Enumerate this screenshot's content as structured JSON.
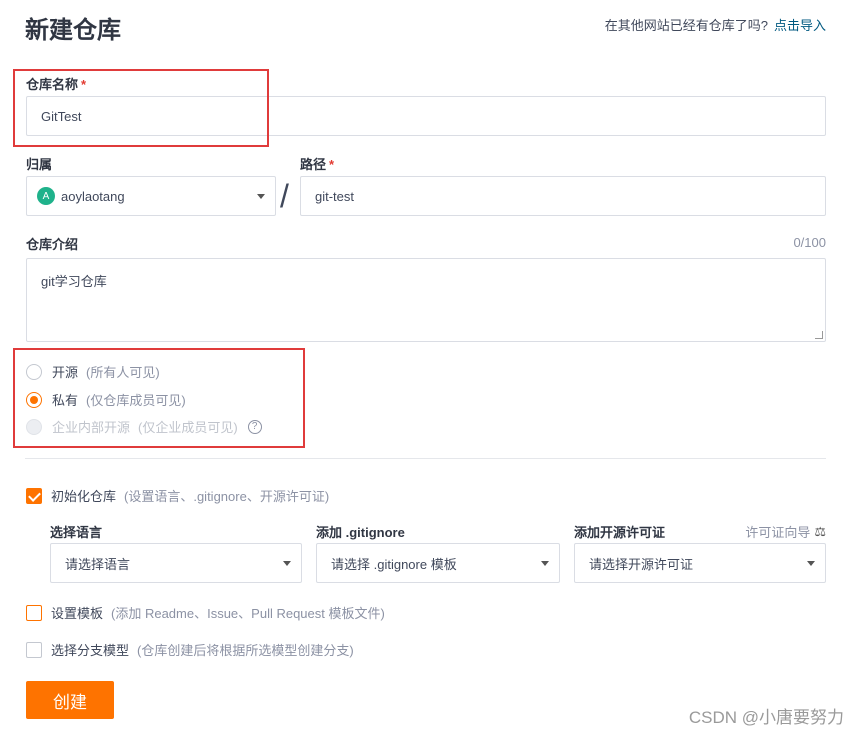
{
  "page": {
    "title": "新建仓库",
    "import_prompt": "在其他网站已经有仓库了吗?",
    "import_link": "点击导入"
  },
  "repo_name": {
    "label": "仓库名称",
    "required_mark": "*",
    "value": "GitTest"
  },
  "owner": {
    "label": "归属",
    "avatar_letter": "A",
    "value": "aoylaotang"
  },
  "separator": "/",
  "path": {
    "label": "路径",
    "required_mark": "*",
    "value": "git-test"
  },
  "description": {
    "label": "仓库介绍",
    "counter": "0/100",
    "value": "git学习仓库"
  },
  "visibility": {
    "options": [
      {
        "label": "开源",
        "hint": "(所有人可见)",
        "state": "unchecked"
      },
      {
        "label": "私有",
        "hint": "(仅仓库成员可见)",
        "state": "checked"
      },
      {
        "label": "企业内部开源",
        "hint": "(仅企业成员可见)",
        "state": "disabled"
      }
    ],
    "help_glyph": "?"
  },
  "init_repo": {
    "label": "初始化仓库",
    "hint": "(设置语言、.gitignore、开源许可证)",
    "checked": true
  },
  "language": {
    "label": "选择语言",
    "placeholder": "请选择语言"
  },
  "gitignore": {
    "label": "添加 .gitignore",
    "placeholder": "请选择 .gitignore 模板"
  },
  "license": {
    "label": "添加开源许可证",
    "placeholder": "请选择开源许可证",
    "guide": "许可证向导",
    "guide_icon": "⚖"
  },
  "template": {
    "label": "设置模板",
    "hint": "(添加 Readme、Issue、Pull Request 模板文件)",
    "checked": false
  },
  "branch_model": {
    "label": "选择分支模型",
    "hint": "(仓库创建后将根据所选模型创建分支)",
    "checked": false
  },
  "create_button": "创建",
  "watermark": "CSDN @小唐要努力",
  "colors": {
    "accent": "#fe7300",
    "highlight_box": "#e03b3b",
    "avatar": "#1fb28b"
  }
}
